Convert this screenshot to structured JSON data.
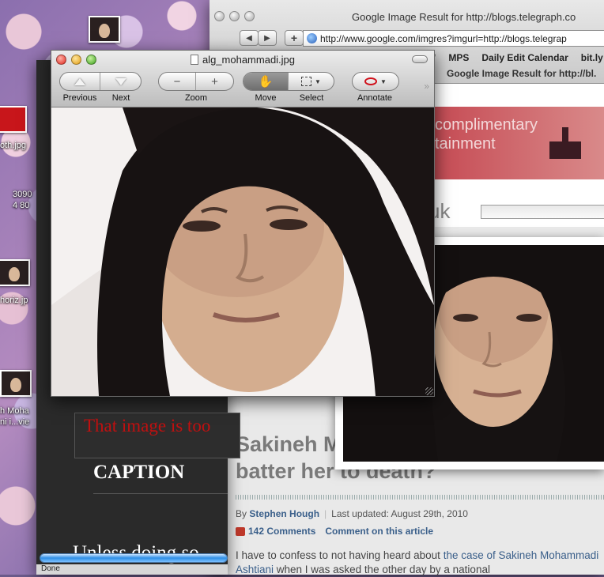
{
  "desktop": {
    "labels": [
      "oth.jpg",
      "3090",
      "4 80",
      "horiz.jp",
      "h Moha",
      "ni i...vie"
    ]
  },
  "browser": {
    "title": "Google Image Result for http://blogs.telegraph.co",
    "url": "http://www.google.com/imgres?imgurl=http://blogs.telegrap",
    "bookmarks": [
      "m\"",
      "MPS",
      "Daily Edit Calendar",
      "bit.ly"
    ],
    "tab_title": "Google Image Result for http://bl.",
    "banner_line1": "complimentary",
    "banner_line2": "tainment",
    "uk_text": "uk"
  },
  "article": {
    "headline_part1": "Sakineh M",
    "headline_part2": "batter her to death?",
    "by_label": "By",
    "author": "Stephen Hough",
    "last_updated": "Last updated: August 29th, 2010",
    "comments_count": "142 Comments",
    "comment_link": "Comment on this article",
    "body_start": "I have to confess to not having heard about ",
    "body_link": "the case of Sakineh Mohammadi Ashtiani",
    "body_end": " when I was asked the other day by a national"
  },
  "darkwin": {
    "error_text": "That image is too",
    "caption": "CAPTION",
    "bottom_text": "Unless doing so",
    "status": "Done"
  },
  "preview": {
    "title": "alg_mohammadi.jpg",
    "labels": {
      "previous": "Previous",
      "next": "Next",
      "zoom": "Zoom",
      "move": "Move",
      "select": "Select",
      "annotate": "Annotate"
    },
    "zoom_out_glyph": "−",
    "zoom_in_glyph": "+",
    "move_glyph": "✋",
    "more_glyph": "»"
  },
  "colors": {
    "annotate_accent": "#d0101a",
    "error_red": "#c01010",
    "link_blue": "#3a5f8a"
  }
}
